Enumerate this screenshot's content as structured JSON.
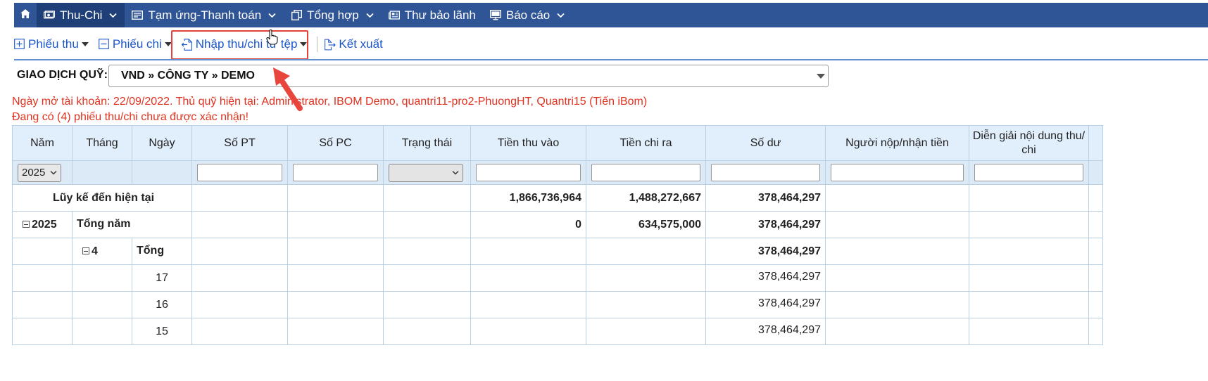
{
  "nav": {
    "home_icon": "home-icon",
    "items": [
      {
        "label": "Thu-Chi",
        "icon": "cash-icon",
        "has_menu": true,
        "active": true
      },
      {
        "label": "Tạm ứng-Thanh toán",
        "icon": "receipt-icon",
        "has_menu": true
      },
      {
        "label": "Tổng hợp",
        "icon": "documents-icon",
        "has_menu": true
      },
      {
        "label": "Thư bảo lãnh",
        "icon": "newspaper-icon",
        "has_menu": false
      },
      {
        "label": "Báo cáo",
        "icon": "monitor-icon",
        "has_menu": true
      }
    ]
  },
  "toolbar": {
    "receipt_label": "Phiếu thu",
    "payment_label": "Phiếu chi",
    "import_label": "Nhập thu/chi từ tệp",
    "export_label": "Kết xuất"
  },
  "fund": {
    "label": "GIAO DỊCH QUỸ:",
    "selected": "VND » CÔNG TY » DEMO"
  },
  "info": {
    "line1": "Ngày mở tài khoản: 22/09/2022. Thủ quỹ hiện tại: Administrator, IBOM Demo, quantri11-pro2-PhuongHT, Quantri15 (Tiến iBom)",
    "line2": "Đang có (4) phiếu thu/chi chưa được xác nhận!"
  },
  "table": {
    "headers": {
      "year": "Năm",
      "month": "Tháng",
      "day": "Ngày",
      "receipt_no": "Số PT",
      "payment_no": "Số PC",
      "status": "Trạng thái",
      "income": "Tiền thu vào",
      "expense": "Tiền chi ra",
      "balance": "Số dư",
      "person": "Người nộp/nhận tiền",
      "description": "Diễn giải nội dung thu/ chi"
    },
    "year_filter": "2025",
    "cumulative": {
      "label": "Lũy kế đến hiện tại",
      "income": "1,866,736,964",
      "expense": "1,488,272,667",
      "balance": "378,464,297"
    },
    "year_row": {
      "year": "2025",
      "label": "Tổng năm",
      "income": "0",
      "expense": "634,575,000",
      "balance": "378,464,297"
    },
    "month_row": {
      "month": "4",
      "label": "Tổng",
      "balance": "378,464,297"
    },
    "day_rows": [
      {
        "day": "17",
        "balance": "378,464,297"
      },
      {
        "day": "16",
        "balance": "378,464,297"
      },
      {
        "day": "15",
        "balance": "378,464,297"
      }
    ]
  }
}
